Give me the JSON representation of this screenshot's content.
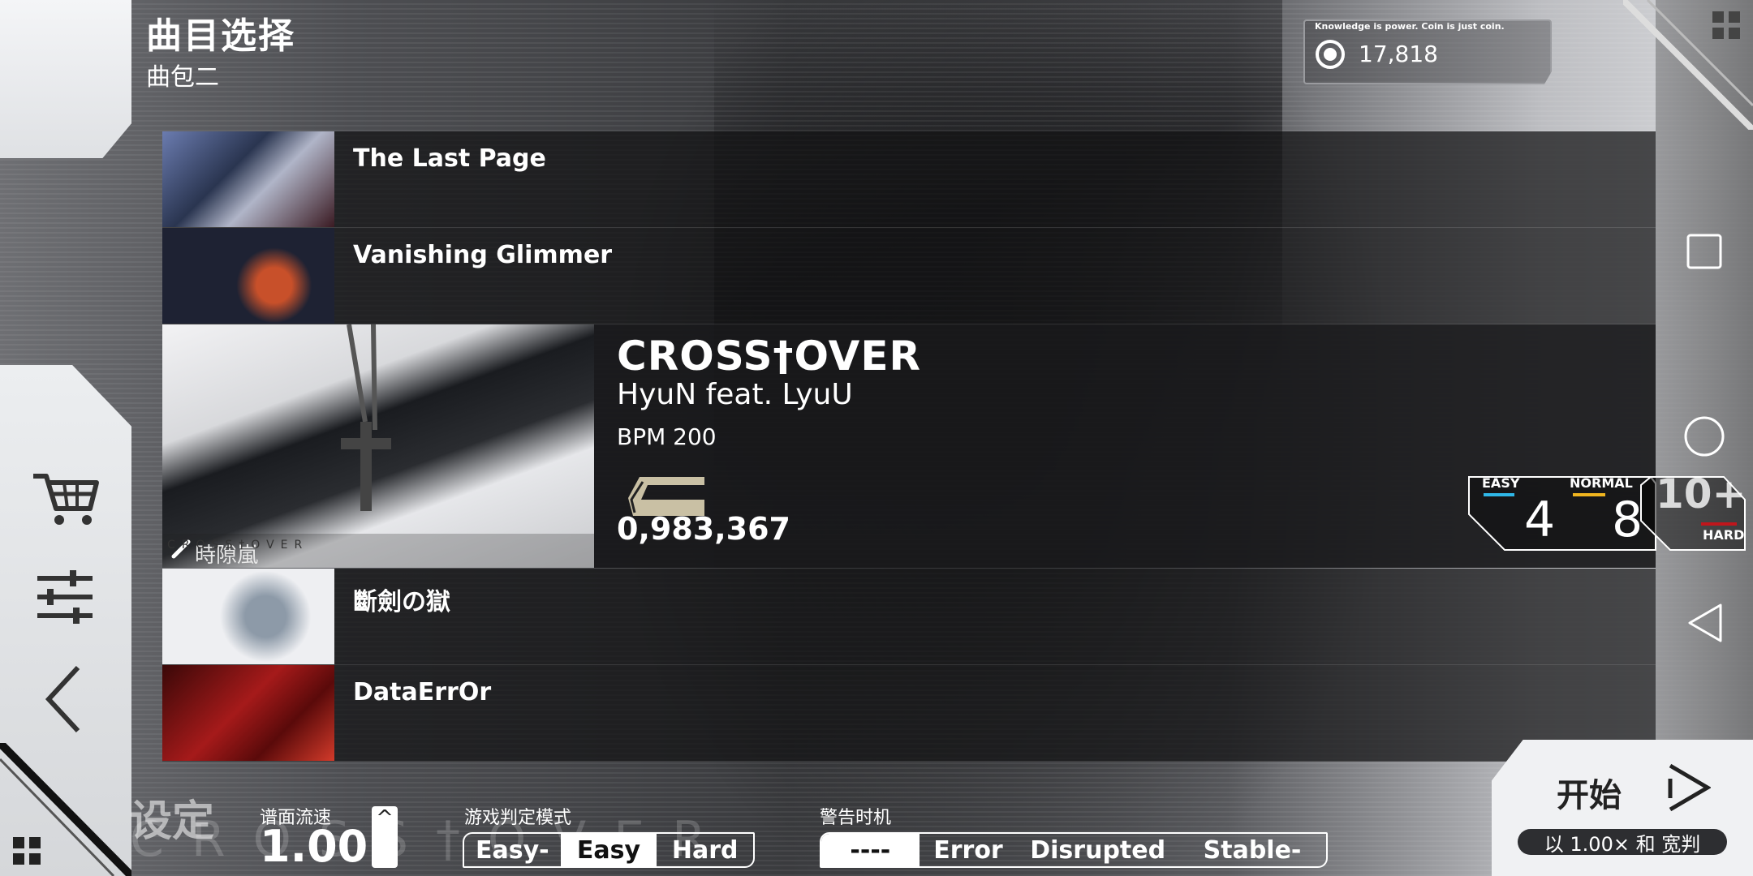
{
  "header": {
    "title": "曲目选择",
    "subtitle": "曲包二"
  },
  "coins": {
    "motto": "Knowledge is power. Coin is just coin.",
    "value": "17,818"
  },
  "sidebar": {
    "items": [
      {
        "icon": "cart-icon"
      },
      {
        "icon": "sliders-icon"
      },
      {
        "icon": "back-chevron-icon"
      }
    ]
  },
  "songs": [
    {
      "name": "The Last Page",
      "art_color": "#2a3550"
    },
    {
      "name": "Vanishing Glimmer",
      "art_color": "#1e2233"
    },
    {
      "name": "斷劍の獄",
      "art_color": "#e7e7ea"
    },
    {
      "name": "DataErrOr",
      "art_color": "#7a1212"
    }
  ],
  "selected_song": {
    "title": "CROSS†OVER",
    "artist": "HyuN feat. LyuU",
    "bpm": "BPM 200",
    "score": "0,983,367",
    "illustrator": "時隙嵐",
    "art_watermark": "CROSS†OVER"
  },
  "difficulty": {
    "easy_label": "EASY",
    "easy_level": "4",
    "easy_color": "#2fb7e8",
    "normal_label": "NORMAL",
    "normal_level": "8",
    "normal_color": "#f0b51f",
    "hard_label": "HARD",
    "hard_level": "10+",
    "hard_color": "#c0161c"
  },
  "bottom": {
    "settings_label": "设定",
    "ghost_text": "CROSS†OVER",
    "speed_label": "谱面流速",
    "speed_value": "1.00",
    "speed_up": "^",
    "judge_label": "游戏判定模式",
    "judge_options": [
      "Easy-",
      "Easy",
      "Hard"
    ],
    "judge_selected": "Easy",
    "warn_label": "警告时机",
    "warn_options": [
      "----",
      "Error",
      "Disrupted",
      "Stable-"
    ],
    "warn_selected": "----"
  },
  "start": {
    "label": "开始",
    "sub": "以 1.00× 和 宽判"
  },
  "nav": {
    "square": "square-icon",
    "circle": "circle-icon",
    "back": "triangle-back-icon",
    "grid": "grid-icon"
  }
}
